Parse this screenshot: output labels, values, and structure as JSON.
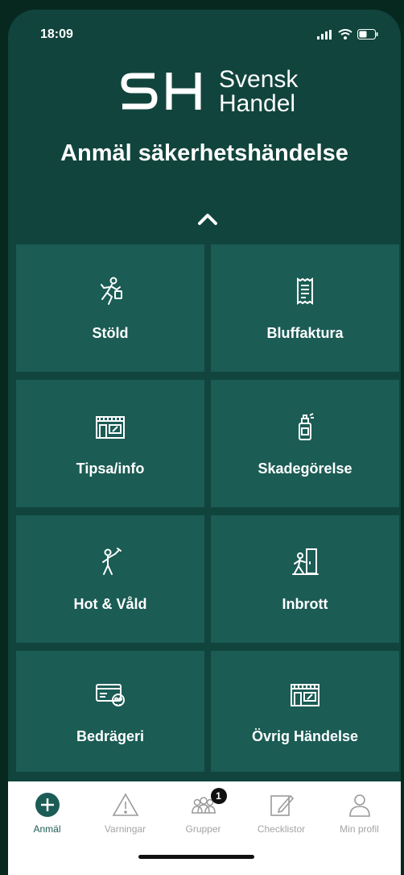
{
  "status_bar": {
    "time": "18:09"
  },
  "logo": {
    "mark": "SH",
    "line1": "Svensk",
    "line2": "Handel"
  },
  "title": "Anmäl säkerhetshändelse",
  "categories": [
    {
      "label": "Stöld",
      "icon": "running-thief-icon"
    },
    {
      "label": "Bluffaktura",
      "icon": "receipt-icon"
    },
    {
      "label": "Tipsa/info",
      "icon": "storefront-icon"
    },
    {
      "label": "Skadegörelse",
      "icon": "spray-can-icon"
    },
    {
      "label": "Hot & Våld",
      "icon": "threat-person-icon"
    },
    {
      "label": "Inbrott",
      "icon": "break-in-door-icon"
    },
    {
      "label": "Bedrägeri",
      "icon": "card-skull-icon"
    },
    {
      "label": "Övrig Händelse",
      "icon": "storefront-icon"
    }
  ],
  "tabs": [
    {
      "label": "Anmäl",
      "icon": "plus-circle-icon",
      "active": true
    },
    {
      "label": "Varningar",
      "icon": "warning-triangle-icon",
      "active": false
    },
    {
      "label": "Grupper",
      "icon": "group-icon",
      "active": false,
      "badge": "1"
    },
    {
      "label": "Checklistor",
      "icon": "edit-note-icon",
      "active": false
    },
    {
      "label": "Min profil",
      "icon": "person-icon",
      "active": false
    }
  ],
  "colors": {
    "background": "#11443c",
    "tile": "#1b5c55",
    "active_tab": "#1b5c55",
    "inactive_tab": "#a4a4a4"
  }
}
